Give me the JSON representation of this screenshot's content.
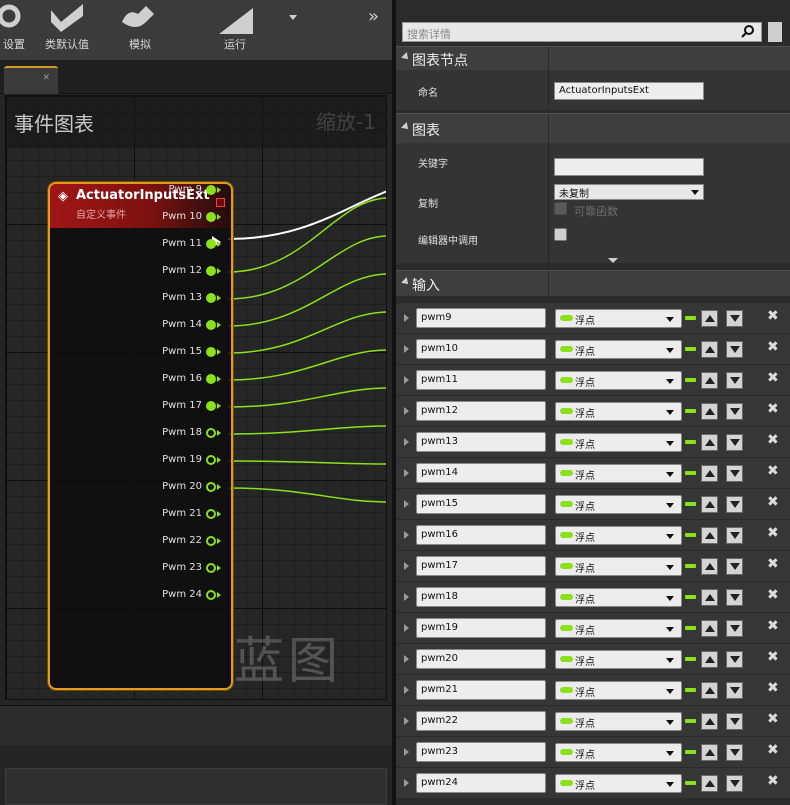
{
  "toolbar": {
    "items": [
      {
        "label": "设置",
        "icon": "gear-icon"
      },
      {
        "label": "类默认值",
        "icon": "class-defaults-icon"
      },
      {
        "label": "模拟",
        "icon": "simulate-icon"
      },
      {
        "label": "运行",
        "icon": "play-icon"
      }
    ],
    "overflow": "»"
  },
  "graph": {
    "title": "事件图表",
    "zoom": "缩放-1",
    "watermark": "蓝图"
  },
  "node": {
    "title": "ActuatorInputsExt",
    "subtitle": "自定义事件",
    "pins": [
      {
        "label": "Pwm 9",
        "connected": true
      },
      {
        "label": "Pwm 10",
        "connected": true
      },
      {
        "label": "Pwm 11",
        "connected": true
      },
      {
        "label": "Pwm 12",
        "connected": true
      },
      {
        "label": "Pwm 13",
        "connected": true
      },
      {
        "label": "Pwm 14",
        "connected": true
      },
      {
        "label": "Pwm 15",
        "connected": true
      },
      {
        "label": "Pwm 16",
        "connected": true
      },
      {
        "label": "Pwm 17",
        "connected": true
      },
      {
        "label": "Pwm 18",
        "connected": false
      },
      {
        "label": "Pwm 19",
        "connected": false
      },
      {
        "label": "Pwm 20",
        "connected": false
      },
      {
        "label": "Pwm 21",
        "connected": false
      },
      {
        "label": "Pwm 22",
        "connected": false
      },
      {
        "label": "Pwm 23",
        "connected": false
      },
      {
        "label": "Pwm 24",
        "connected": false
      }
    ]
  },
  "details": {
    "search_placeholder": "搜索详情",
    "graph_node_category": "图表节点",
    "name_label": "命名",
    "name_value": "ActuatorInputsExt",
    "graph_category": "图表",
    "keywords_label": "关键字",
    "keywords_value": "",
    "replicate_label": "复制",
    "replicate_value": "未复制",
    "pure_label": "可靠函数",
    "call_in_editor_label": "编辑器中调用",
    "inputs_category": "输入",
    "inputs": [
      {
        "name": "pwm9",
        "type": "浮点"
      },
      {
        "name": "pwm10",
        "type": "浮点"
      },
      {
        "name": "pwm11",
        "type": "浮点"
      },
      {
        "name": "pwm12",
        "type": "浮点"
      },
      {
        "name": "pwm13",
        "type": "浮点"
      },
      {
        "name": "pwm14",
        "type": "浮点"
      },
      {
        "name": "pwm15",
        "type": "浮点"
      },
      {
        "name": "pwm16",
        "type": "浮点"
      },
      {
        "name": "pwm17",
        "type": "浮点"
      },
      {
        "name": "pwm18",
        "type": "浮点"
      },
      {
        "name": "pwm19",
        "type": "浮点"
      },
      {
        "name": "pwm20",
        "type": "浮点"
      },
      {
        "name": "pwm21",
        "type": "浮点"
      },
      {
        "name": "pwm22",
        "type": "浮点"
      },
      {
        "name": "pwm23",
        "type": "浮点"
      },
      {
        "name": "pwm24",
        "type": "浮点"
      }
    ]
  },
  "colors": {
    "float_pin": "#8ae21a",
    "node_border": "#e49a1a",
    "event_header": "#a11616"
  }
}
